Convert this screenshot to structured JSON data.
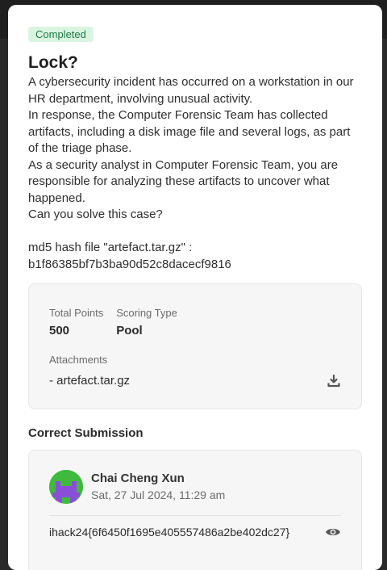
{
  "challenge": {
    "status_badge": "Completed",
    "title": "Lock?",
    "description": [
      "A cybersecurity incident has occurred on a workstation in our HR department, involving unusual activity.",
      "In response, the Computer Forensic Team has collected artifacts, including a disk image file and several logs, as part of the triage phase.",
      "As a security analyst in Computer Forensic Team, you are responsible for analyzing these artifacts to uncover what happened.",
      "Can you solve this case?"
    ],
    "hash_label": "md5 hash file \"artefact.tar.gz\" :",
    "hash_value": "b1f86385bf7b3ba90d52c8dacecf9816"
  },
  "info": {
    "total_points_label": "Total Points",
    "total_points_value": "500",
    "scoring_type_label": "Scoring Type",
    "scoring_type_value": "Pool",
    "attachments_label": "Attachments",
    "attachment_file": "- artefact.tar.gz",
    "download_icon": "download-icon"
  },
  "submission": {
    "section_title": "Correct Submission",
    "user_name": "Chai Cheng Xun",
    "timestamp": "Sat, 27 Jul 2024, 11:29 am",
    "flag": "ihack24{6f6450f1695e405557486a2be402dc27}",
    "reveal_icon": "eye-icon"
  },
  "colors": {
    "badge_bg": "#d9f5e2",
    "badge_text": "#1f7a45",
    "avatar_bg": "#3fba3f",
    "avatar_fg": "#8a4fd6"
  }
}
